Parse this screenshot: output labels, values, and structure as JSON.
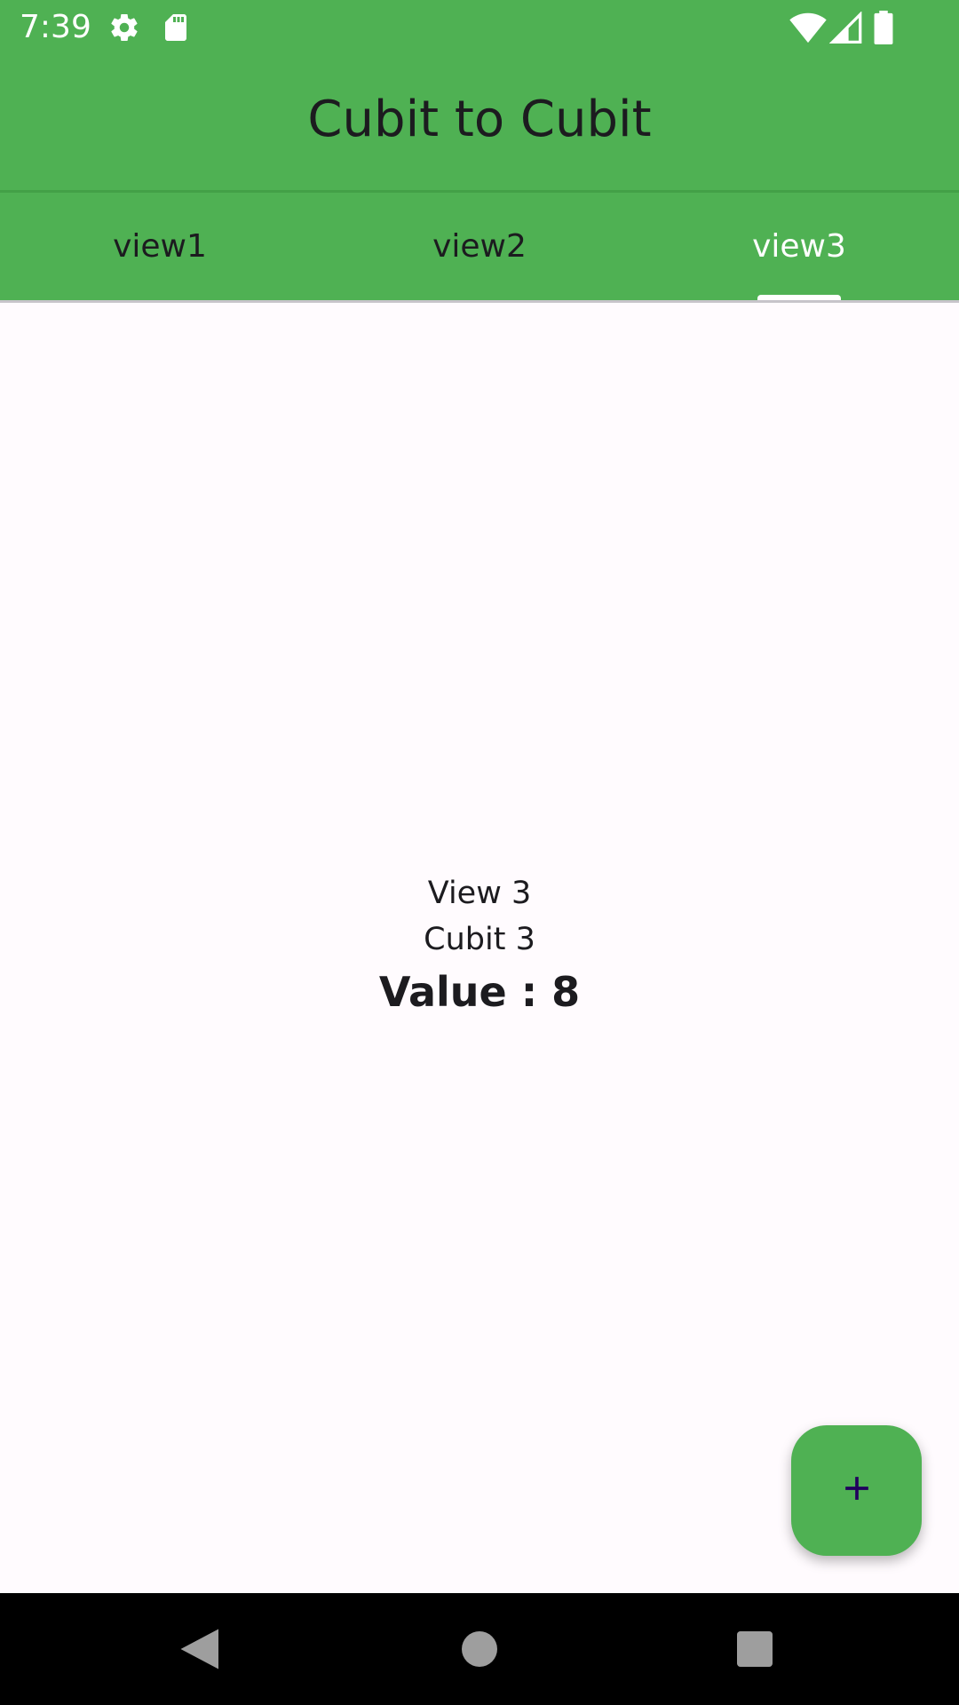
{
  "status_bar": {
    "time": "7:39",
    "icons": [
      "gear-icon",
      "sd-card-icon",
      "wifi-icon",
      "cell-signal-icon",
      "battery-icon"
    ]
  },
  "app_bar": {
    "title": "Cubit to Cubit",
    "background": "#4fb153"
  },
  "tabs": [
    {
      "label": "view1",
      "active": false
    },
    {
      "label": "view2",
      "active": false
    },
    {
      "label": "view3",
      "active": true
    }
  ],
  "content": {
    "view_label": "View 3",
    "cubit_label": "Cubit 3",
    "value_text": "Value : 8"
  },
  "fab": {
    "icon": "plus-icon",
    "color": "#4fb153",
    "icon_color": "#21005d"
  },
  "nav_bar": {
    "buttons": [
      "back-icon",
      "home-icon",
      "recents-icon"
    ]
  }
}
